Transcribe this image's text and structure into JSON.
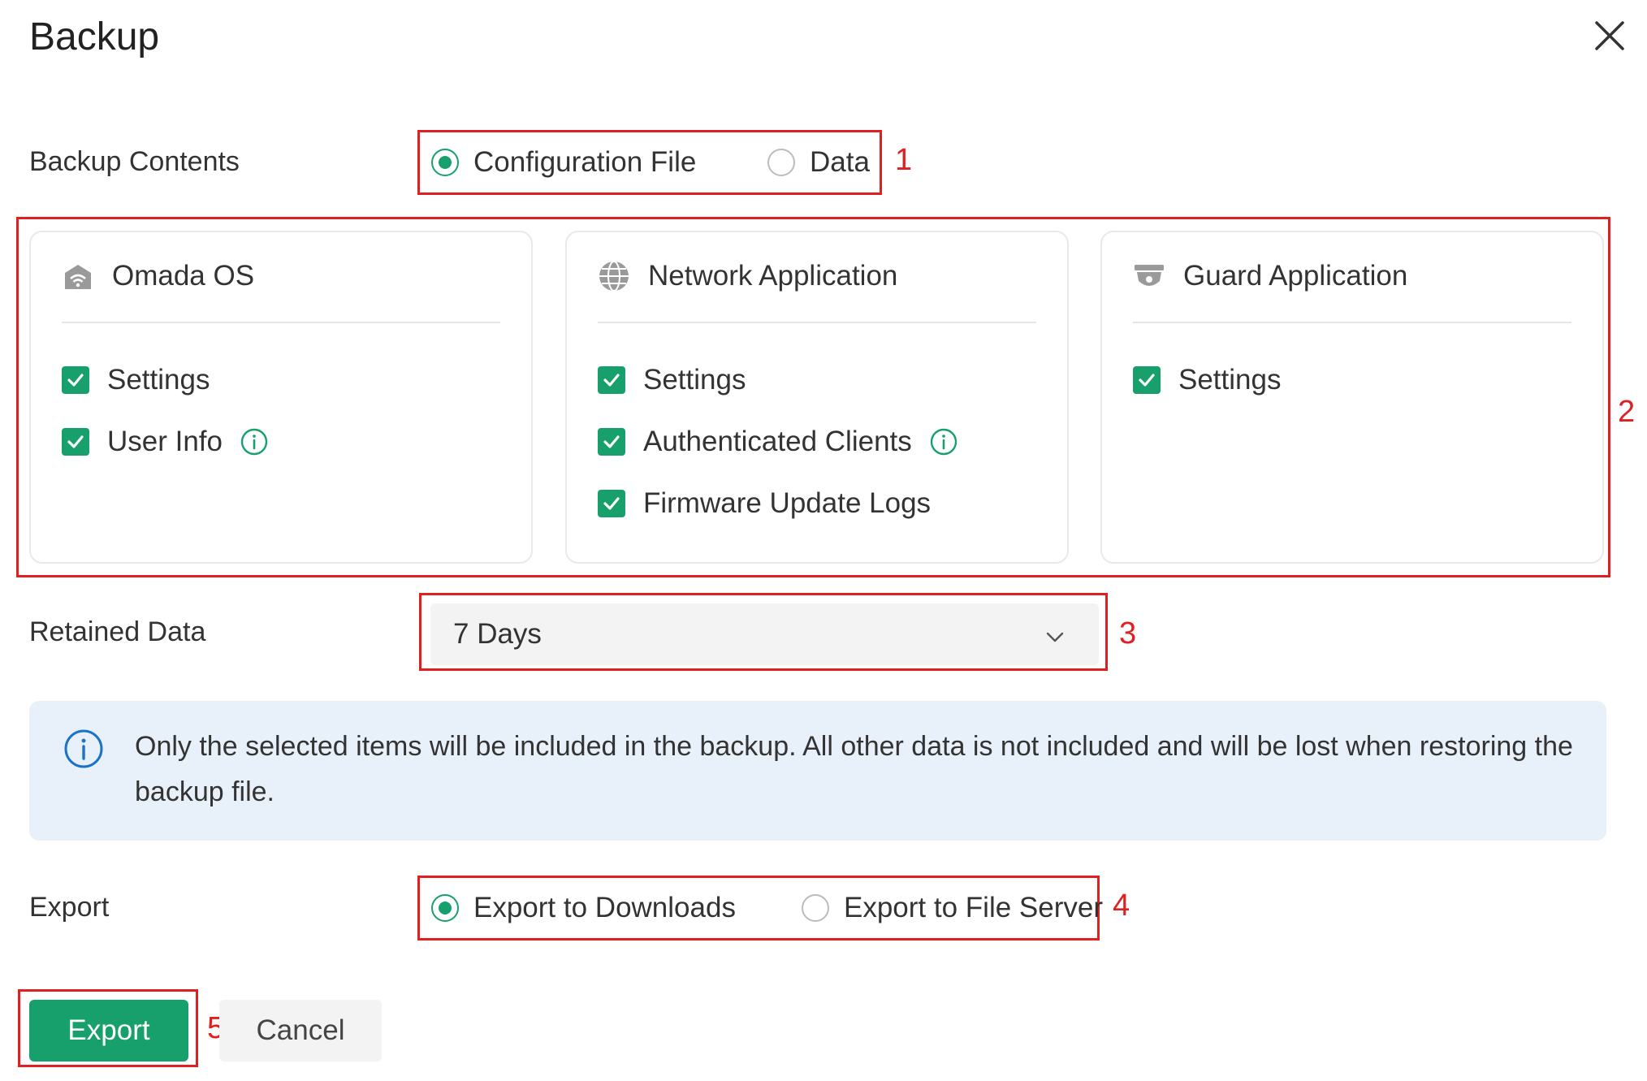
{
  "dialog": {
    "title": "Backup"
  },
  "backup_contents": {
    "label": "Backup Contents",
    "options": [
      "Configuration File",
      "Data"
    ],
    "selected": "Configuration File"
  },
  "cards": [
    {
      "title": "Omada OS",
      "icon": "omada-os-icon",
      "items": [
        {
          "label": "Settings",
          "checked": true
        },
        {
          "label": "User Info",
          "checked": true,
          "info": true
        }
      ]
    },
    {
      "title": "Network Application",
      "icon": "globe-icon",
      "items": [
        {
          "label": "Settings",
          "checked": true
        },
        {
          "label": "Authenticated Clients",
          "checked": true,
          "info": true
        },
        {
          "label": "Firmware Update Logs",
          "checked": true
        }
      ]
    },
    {
      "title": "Guard Application",
      "icon": "camera-icon",
      "items": [
        {
          "label": "Settings",
          "checked": true
        }
      ]
    }
  ],
  "retained_data": {
    "label": "Retained Data",
    "value": "7 Days"
  },
  "notice": {
    "text": "Only the selected items will be included in the backup. All other data is not included and will be lost when restoring the backup file."
  },
  "export": {
    "label": "Export",
    "options": [
      "Export to Downloads",
      "Export to File Server"
    ],
    "selected": "Export to Downloads"
  },
  "buttons": {
    "export": "Export",
    "cancel": "Cancel"
  },
  "markers": [
    "1",
    "2",
    "3",
    "4",
    "5"
  ],
  "colors": {
    "accent": "#17a06b",
    "annotation": "#e02020",
    "notice_bg": "#e8f1fa"
  }
}
